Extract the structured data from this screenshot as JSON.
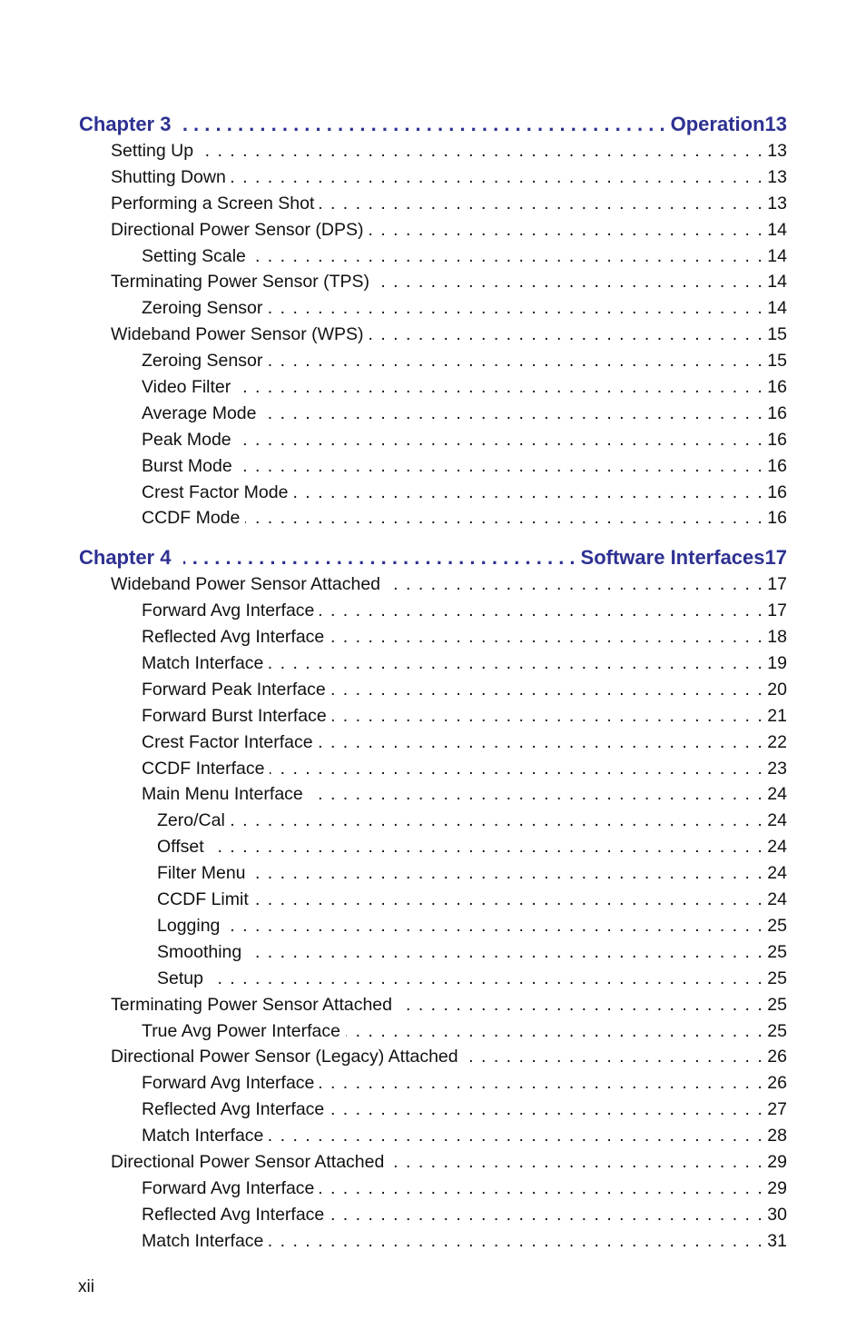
{
  "toc": [
    {
      "chapter_label": "Chapter 3",
      "chapter_title": "Operation",
      "chapter_page": "13",
      "entries": [
        {
          "level": 1,
          "title": "Setting Up",
          "page": "13"
        },
        {
          "level": 1,
          "title": "Shutting Down",
          "page": "13"
        },
        {
          "level": 1,
          "title": "Performing a Screen Shot",
          "page": "13"
        },
        {
          "level": 1,
          "title": "Directional Power Sensor (DPS)",
          "page": "14"
        },
        {
          "level": 2,
          "title": "Setting Scale",
          "page": "14"
        },
        {
          "level": 1,
          "title": "Terminating Power Sensor (TPS)",
          "page": "14"
        },
        {
          "level": 2,
          "title": "Zeroing Sensor",
          "page": "14"
        },
        {
          "level": 1,
          "title": "Wideband Power Sensor (WPS)",
          "page": "15"
        },
        {
          "level": 2,
          "title": "Zeroing Sensor",
          "page": "15"
        },
        {
          "level": 2,
          "title": "Video Filter",
          "page": "16"
        },
        {
          "level": 2,
          "title": "Average Mode",
          "page": "16"
        },
        {
          "level": 2,
          "title": "Peak Mode",
          "page": "16"
        },
        {
          "level": 2,
          "title": "Burst Mode",
          "page": "16"
        },
        {
          "level": 2,
          "title": "Crest Factor Mode",
          "page": "16"
        },
        {
          "level": 2,
          "title": "CCDF Mode",
          "page": "16"
        }
      ]
    },
    {
      "chapter_label": "Chapter 4",
      "chapter_title": "Software Interfaces",
      "chapter_page": "17",
      "entries": [
        {
          "level": 1,
          "title": "Wideband Power Sensor Attached",
          "page": "17"
        },
        {
          "level": 2,
          "title": "Forward Avg Interface",
          "page": "17"
        },
        {
          "level": 2,
          "title": "Reflected Avg Interface",
          "page": "18"
        },
        {
          "level": 2,
          "title": "Match Interface",
          "page": "19"
        },
        {
          "level": 2,
          "title": "Forward Peak Interface",
          "page": "20"
        },
        {
          "level": 2,
          "title": "Forward Burst Interface",
          "page": "21"
        },
        {
          "level": 2,
          "title": "Crest Factor Interface",
          "page": "22"
        },
        {
          "level": 2,
          "title": "CCDF Interface",
          "page": "23"
        },
        {
          "level": 2,
          "title": "Main Menu Interface",
          "page": "24"
        },
        {
          "level": 3,
          "title": "Zero/Cal",
          "page": "24"
        },
        {
          "level": 3,
          "title": "Offset",
          "page": "24"
        },
        {
          "level": 3,
          "title": "Filter Menu",
          "page": "24"
        },
        {
          "level": 3,
          "title": "CCDF Limit",
          "page": "24"
        },
        {
          "level": 3,
          "title": "Logging",
          "page": "25"
        },
        {
          "level": 3,
          "title": "Smoothing",
          "page": "25"
        },
        {
          "level": 3,
          "title": "Setup",
          "page": "25"
        },
        {
          "level": 1,
          "title": "Terminating Power Sensor Attached",
          "page": "25"
        },
        {
          "level": 2,
          "title": "True Avg Power Interface",
          "page": "25"
        },
        {
          "level": 1,
          "title": "Directional Power Sensor (Legacy) Attached",
          "page": "26"
        },
        {
          "level": 2,
          "title": "Forward Avg Interface",
          "page": "26"
        },
        {
          "level": 2,
          "title": "Reflected Avg Interface",
          "page": "27"
        },
        {
          "level": 2,
          "title": "Match Interface",
          "page": "28"
        },
        {
          "level": 1,
          "title": "Directional Power Sensor Attached",
          "page": "29"
        },
        {
          "level": 2,
          "title": "Forward Avg Interface",
          "page": "29"
        },
        {
          "level": 2,
          "title": "Reflected Avg Interface",
          "page": "30"
        },
        {
          "level": 2,
          "title": "Match Interface",
          "page": "31"
        }
      ]
    }
  ],
  "colors": {
    "chapter": "#2e3192",
    "text": "#111111"
  },
  "folio": "xii"
}
